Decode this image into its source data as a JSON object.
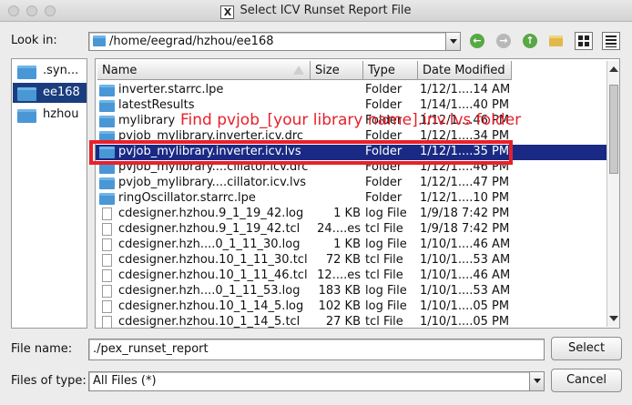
{
  "window": {
    "title": "Select ICV Runset Report File"
  },
  "look_in": {
    "label": "Look in:",
    "path": "/home/eegrad/hzhou/ee168"
  },
  "toolbar_icons": [
    "back-icon",
    "forward-icon",
    "parent-directory-icon",
    "new-folder-icon",
    "list-view-icon",
    "detail-view-icon"
  ],
  "sidebar": {
    "items": [
      {
        "label": ".syn..."
      },
      {
        "label": "ee168"
      },
      {
        "label": "hzhou"
      }
    ]
  },
  "file_list": {
    "columns": [
      "Name",
      "Size",
      "Type",
      "Date Modified"
    ],
    "rows": [
      {
        "name": "inverter.starrc.lpe",
        "size": "",
        "type": "Folder",
        "date": "1/12/1....14 AM",
        "kind": "folder"
      },
      {
        "name": "latestResults",
        "size": "",
        "type": "Folder",
        "date": "1/14/1....40 PM",
        "kind": "folder"
      },
      {
        "name": "mylibrary",
        "size": "",
        "type": "Folder",
        "date": "1/12/1....46 PM",
        "kind": "folder"
      },
      {
        "name": "pvjob_mylibrary.inverter.icv.drc",
        "size": "",
        "type": "Folder",
        "date": "1/12/1....34 PM",
        "kind": "folder"
      },
      {
        "name": "pvjob_mylibrary.inverter.icv.lvs",
        "size": "",
        "type": "Folder",
        "date": "1/12/1....35 PM",
        "kind": "folder"
      },
      {
        "name": "pvjob_mylibrary....cillator.icv.drc",
        "size": "",
        "type": "Folder",
        "date": "1/12/1....46 PM",
        "kind": "folder"
      },
      {
        "name": "pvjob_mylibrary....cillator.icv.lvs",
        "size": "",
        "type": "Folder",
        "date": "1/12/1....47 PM",
        "kind": "folder"
      },
      {
        "name": "ringOscillator.starrc.lpe",
        "size": "",
        "type": "Folder",
        "date": "1/12/1....10 PM",
        "kind": "folder"
      },
      {
        "name": "cdesigner.hzhou.9_1_19_42.log",
        "size": "1 KB",
        "type": "log File",
        "date": "1/9/18 7:42 PM",
        "kind": "file"
      },
      {
        "name": "cdesigner.hzhou.9_1_19_42.tcl",
        "size": "24....es",
        "type": "tcl File",
        "date": "1/9/18 7:42 PM",
        "kind": "file"
      },
      {
        "name": "cdesigner.hzh....0_1_11_30.log",
        "size": "1 KB",
        "type": "log File",
        "date": "1/10/1....46 AM",
        "kind": "file"
      },
      {
        "name": "cdesigner.hzhou.10_1_11_30.tcl",
        "size": "72 KB",
        "type": "tcl File",
        "date": "1/10/1....53 AM",
        "kind": "file"
      },
      {
        "name": "cdesigner.hzhou.10_1_11_46.tcl",
        "size": "12....es",
        "type": "tcl File",
        "date": "1/10/1....46 AM",
        "kind": "file"
      },
      {
        "name": "cdesigner.hzh....0_1_11_53.log",
        "size": "183 KB",
        "type": "log File",
        "date": "1/10/1....53 AM",
        "kind": "file"
      },
      {
        "name": "cdesigner.hzhou.10_1_14_5.log",
        "size": "102 KB",
        "type": "log File",
        "date": "1/10/1....05 PM",
        "kind": "file"
      },
      {
        "name": "cdesigner.hzhou.10_1_14_5.tcl",
        "size": "27 KB",
        "type": "tcl File",
        "date": "1/10/1....05 PM",
        "kind": "file"
      }
    ],
    "selected_index": 4
  },
  "annotation": {
    "text": "Find pvjob_[your library name].inv.lvs folder",
    "color": "#e8202a"
  },
  "file_name": {
    "label": "File name:",
    "value": "./pex_runset_report"
  },
  "files_of_type": {
    "label": "Files of type:",
    "value": "All Files (*)"
  },
  "buttons": {
    "select": "Select",
    "cancel": "Cancel"
  },
  "colors": {
    "selection": "#1a2a84",
    "folder": "#4a97d6",
    "back_forward": "#58a845",
    "annotation": "#e8202a"
  }
}
